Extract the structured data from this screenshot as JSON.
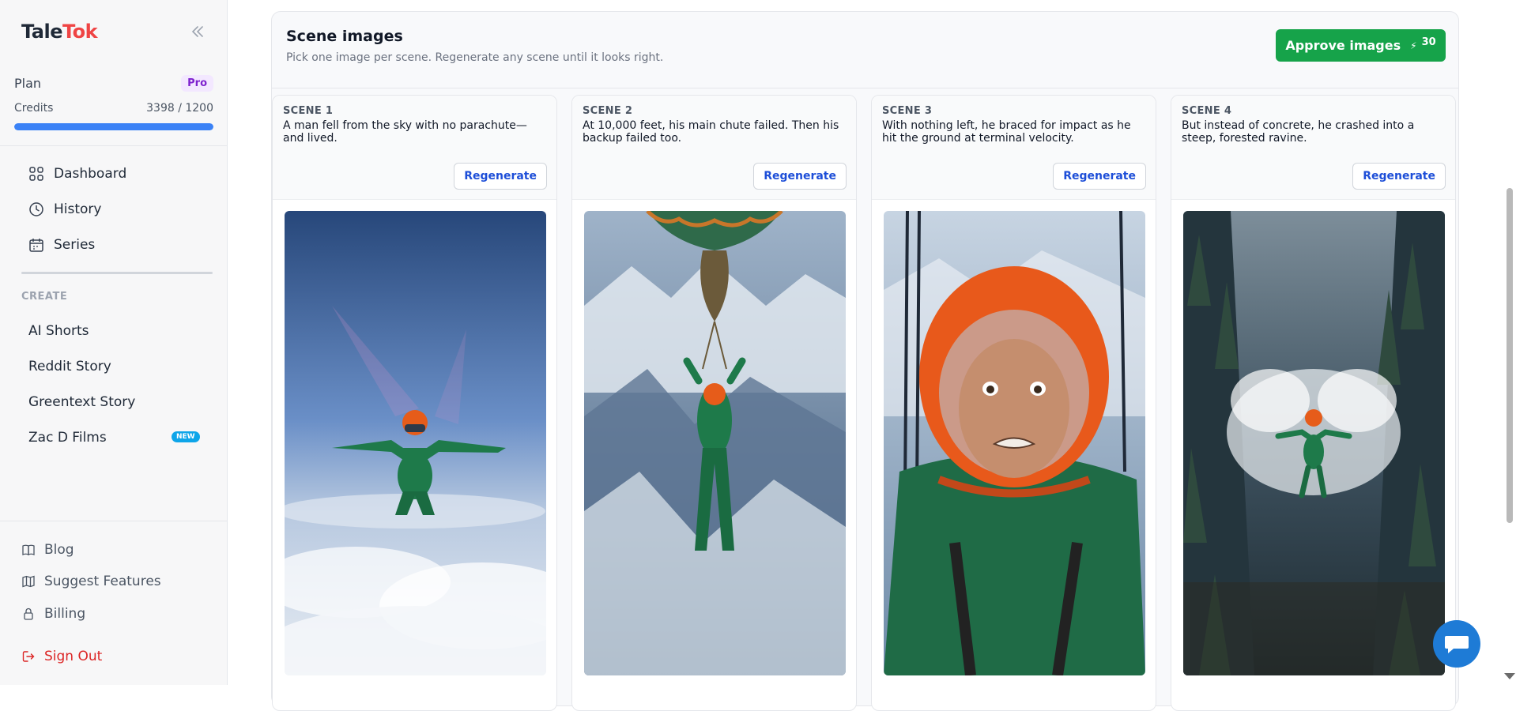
{
  "brand": {
    "part1": "Tale",
    "part2": "Tok"
  },
  "plan": {
    "label": "Plan",
    "badge": "Pro"
  },
  "credits": {
    "label": "Credits",
    "value": "3398 / 1200",
    "fill_fraction": 1.0
  },
  "nav": [
    {
      "label": "Dashboard",
      "icon": "grid-icon"
    },
    {
      "label": "History",
      "icon": "clock-icon"
    },
    {
      "label": "Series",
      "icon": "calendar-icon"
    }
  ],
  "create": {
    "heading": "CREATE",
    "items": [
      "AI Shorts",
      "Reddit Story",
      "Greentext Story",
      "Zac D Films"
    ],
    "new_badge": "NEW"
  },
  "footer": [
    {
      "label": "Blog",
      "icon": "book-icon"
    },
    {
      "label": "Suggest Features",
      "icon": "map-icon"
    },
    {
      "label": "Billing",
      "icon": "lock-icon"
    },
    {
      "label": "Sign Out",
      "icon": "sign-out-icon"
    }
  ],
  "main": {
    "title": "Scene images",
    "subtitle": "Pick one image per scene. Regenerate any scene until it looks right.",
    "approve_label": "Approve images",
    "approve_cost": "30",
    "regenerate_label": "Regenerate",
    "scenes": [
      {
        "label": "SCENE 1",
        "text": "A man fell from the sky with no parachute—and lived."
      },
      {
        "label": "SCENE 2",
        "text": "At 10,000 feet, his main chute failed. Then his backup failed too."
      },
      {
        "label": "SCENE 3",
        "text": "With nothing left, he braced for impact as he hit the ground at terminal velocity."
      },
      {
        "label": "SCENE 4",
        "text": "But instead of concrete, he crashed into a steep, forested ravine."
      }
    ]
  }
}
